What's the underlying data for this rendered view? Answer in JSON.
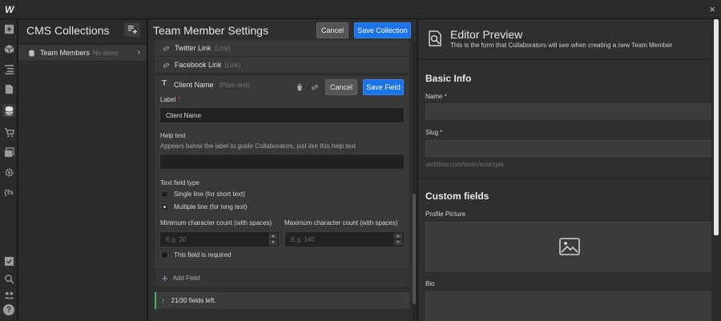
{
  "app": {
    "logo": "W",
    "close_icon": "×"
  },
  "rail": {
    "icons": [
      "add-panel-icon",
      "components-icon",
      "navigator-icon",
      "pages-icon",
      "cms-icon",
      "ecommerce-icon",
      "assets-icon",
      "settings-icon",
      "logic-icon",
      "tasks-icon",
      "search-icon",
      "team-icon",
      "help-icon"
    ],
    "logic_glyph": "{fs",
    "help_glyph": "?"
  },
  "collections": {
    "title": "CMS Collections",
    "items": [
      {
        "name": "Team Members",
        "count": "No items"
      }
    ],
    "chevron": "›"
  },
  "settings": {
    "title": "Team Member Settings",
    "cancel_label": "Cancel",
    "save_collection_label": "Save Collection",
    "fields": [
      {
        "name": "Twitter Link",
        "type": "(Link)"
      },
      {
        "name": "Facebook Link",
        "type": "(Link)"
      }
    ],
    "editing": {
      "icon_glyph": "T",
      "name": "Client Name",
      "type": "(Plain text)",
      "cancel_label": "Cancel",
      "save_label": "Save Field",
      "label_label": "Label",
      "required_mark": "*",
      "label_value": "Client Name",
      "help_label": "Help text",
      "help_sub": "Appears below the label to guide Collaborators, just like this help text",
      "help_value": "",
      "type_label": "Text field type",
      "single_line": "Single line (for short text)",
      "multi_line": "Multiple line (for long text)",
      "selected_type": "multi_line",
      "min_label": "Minimum character count (with spaces)",
      "min_placeholder": "E.g. 20",
      "max_label": "Maximum character count (with spaces)",
      "max_placeholder": "E.g. 140",
      "step_up": "▲",
      "step_down": "▼",
      "required_label": "This field is required"
    },
    "add_field_label": "Add Field",
    "add_glyph": "+",
    "fields_left": "21/30 fields left.",
    "fields_left_glyph": "↑"
  },
  "preview": {
    "title": "Editor Preview",
    "subtitle": "This is the form that Collaborators will see when creating a new Team Member",
    "basic_info_title": "Basic Info",
    "name_label": "Name *",
    "slug_label": "Slug *",
    "slug_url": "webflow.com/team/example",
    "custom_fields_title": "Custom fields",
    "profile_picture_label": "Profile Picture",
    "bio_label": "Bio"
  },
  "colors": {
    "accent": "#1a73e8",
    "success": "#46b36b",
    "background": "#2f2f2f"
  }
}
